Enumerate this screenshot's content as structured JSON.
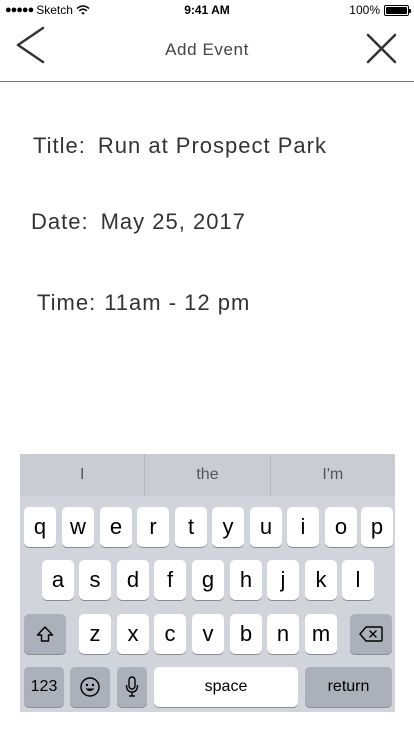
{
  "status_bar": {
    "carrier": "Sketch",
    "time": "9:41 AM",
    "battery": "100%"
  },
  "nav": {
    "title": "Add Event"
  },
  "form": {
    "title_label": "Title:",
    "title_value": "Run at Prospect Park",
    "date_label": "Date:",
    "date_value": "May 25, 2017",
    "time_label": "Time:",
    "time_value": "11am - 12 pm"
  },
  "keyboard": {
    "suggestions": [
      "I",
      "the",
      "I'm"
    ],
    "row1": [
      "q",
      "w",
      "e",
      "r",
      "t",
      "y",
      "u",
      "i",
      "o",
      "p"
    ],
    "row2": [
      "a",
      "s",
      "d",
      "f",
      "g",
      "h",
      "j",
      "k",
      "l"
    ],
    "row3": [
      "z",
      "x",
      "c",
      "v",
      "b",
      "n",
      "m"
    ],
    "numbers_label": "123",
    "space_label": "space",
    "return_label": "return"
  }
}
